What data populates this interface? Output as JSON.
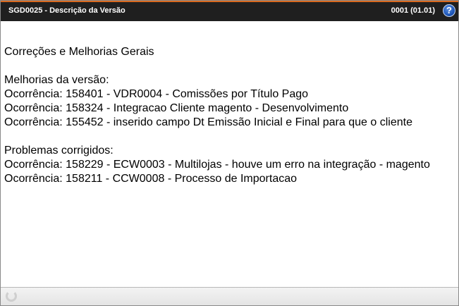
{
  "window": {
    "title": "SGD0025 - Descrição da Versão",
    "version": "0001 (01.01)",
    "help_symbol": "?"
  },
  "content": {
    "heading": "Correções e Melhorias Gerais",
    "improvements_title": "Melhorias da versão:",
    "improvements": [
      "Ocorrência: 158401 - VDR0004 - Comissões por Título Pago",
      "Ocorrência: 158324 - Integracao Cliente magento - Desenvolvimento",
      "Ocorrência: 155452 - inserido campo Dt Emissão Inicial e Final para que o cliente"
    ],
    "fixes_title": "Problemas corrigidos:",
    "fixes": [
      "Ocorrência: 158229 - ECW0003 - Multilojas - houve um erro na integração - magento",
      "Ocorrência: 158211 - CCW0008 - Processo de Importacao"
    ]
  },
  "colors": {
    "titlebar_bg": "#1f1f1f",
    "titlebar_accent": "#d9691f",
    "help_icon": "#1e56b8"
  },
  "icons": {
    "help": "help-icon",
    "loading": "spinner-icon"
  }
}
